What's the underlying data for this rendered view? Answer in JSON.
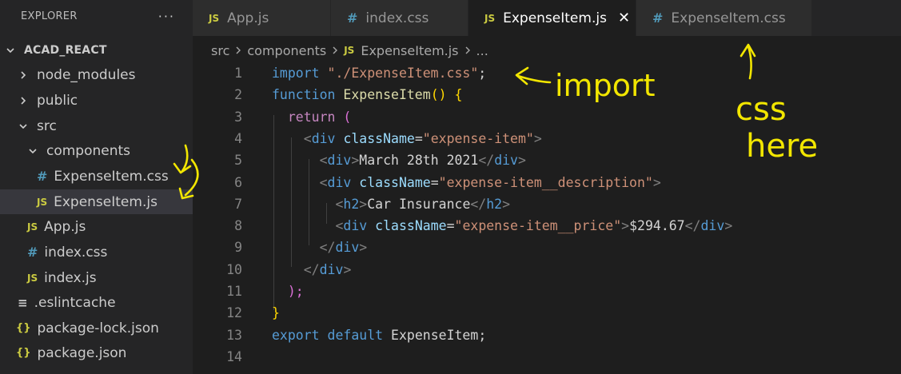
{
  "explorer": {
    "title": "EXPLORER",
    "more": "···",
    "root": "ACAD_REACT",
    "items": [
      {
        "label": "node_modules",
        "icon": "folder-chevron-right-icon"
      },
      {
        "label": "public",
        "icon": "folder-chevron-right-icon"
      },
      {
        "label": "src",
        "icon": "folder-chevron-down-icon"
      },
      {
        "label": "components",
        "icon": "folder-chevron-down-icon"
      },
      {
        "label": "ExpenseItem.css",
        "icon": "css-file-icon",
        "glyph": "#"
      },
      {
        "label": "ExpenseItem.js",
        "icon": "js-file-icon",
        "glyph": "JS",
        "selected": true
      },
      {
        "label": "App.js",
        "icon": "js-file-icon",
        "glyph": "JS"
      },
      {
        "label": "index.css",
        "icon": "css-file-icon",
        "glyph": "#"
      },
      {
        "label": "index.js",
        "icon": "js-file-icon",
        "glyph": "JS"
      },
      {
        "label": ".eslintcache",
        "icon": "lines-file-icon",
        "glyph": "≡"
      },
      {
        "label": "package-lock.json",
        "icon": "json-file-icon",
        "glyph": "{}"
      },
      {
        "label": "package.json",
        "icon": "json-file-icon",
        "glyph": "{}"
      }
    ]
  },
  "tabs": [
    {
      "label": "App.js",
      "glyph": "JS"
    },
    {
      "label": "index.css",
      "glyph": "#"
    },
    {
      "label": "ExpenseItem.js",
      "glyph": "JS",
      "active": true,
      "close": "✕"
    },
    {
      "label": "ExpenseItem.css",
      "glyph": "#"
    }
  ],
  "breadcrumb": {
    "parts": [
      "src",
      "components"
    ],
    "file_glyph": "JS",
    "file": "ExpenseItem.js",
    "tail": "..."
  },
  "code": {
    "line_numbers": [
      "1",
      "2",
      "3",
      "4",
      "5",
      "6",
      "7",
      "8",
      "9",
      "10",
      "11",
      "12",
      "13",
      "14"
    ],
    "lines": [
      [
        {
          "t": "import ",
          "c": "kw"
        },
        {
          "t": "\"./ExpenseItem.css\"",
          "c": "str"
        },
        {
          "t": ";",
          "c": "txt"
        }
      ],
      [
        {
          "t": "function ",
          "c": "kw"
        },
        {
          "t": "ExpenseItem",
          "c": "fn"
        },
        {
          "t": "() ",
          "c": "p1"
        },
        {
          "t": "{",
          "c": "p1"
        }
      ],
      [
        {
          "t": "  "
        },
        {
          "t": "return ",
          "c": "ctl"
        },
        {
          "t": "(",
          "c": "p2"
        }
      ],
      [
        {
          "t": "    "
        },
        {
          "t": "<",
          "c": "tagb"
        },
        {
          "t": "div ",
          "c": "tag"
        },
        {
          "t": "className",
          "c": "attr"
        },
        {
          "t": "=",
          "c": "txt"
        },
        {
          "t": "\"expense-item\"",
          "c": "str"
        },
        {
          "t": ">",
          "c": "tagb"
        }
      ],
      [
        {
          "t": "      "
        },
        {
          "t": "<",
          "c": "tagb"
        },
        {
          "t": "div",
          "c": "tag"
        },
        {
          "t": ">",
          "c": "tagb"
        },
        {
          "t": "March 28th 2021",
          "c": "txt"
        },
        {
          "t": "</",
          "c": "tagb"
        },
        {
          "t": "div",
          "c": "tag"
        },
        {
          "t": ">",
          "c": "tagb"
        }
      ],
      [
        {
          "t": "      "
        },
        {
          "t": "<",
          "c": "tagb"
        },
        {
          "t": "div ",
          "c": "tag"
        },
        {
          "t": "className",
          "c": "attr"
        },
        {
          "t": "=",
          "c": "txt"
        },
        {
          "t": "\"expense-item__description\"",
          "c": "str"
        },
        {
          "t": ">",
          "c": "tagb"
        }
      ],
      [
        {
          "t": "        "
        },
        {
          "t": "<",
          "c": "tagb"
        },
        {
          "t": "h2",
          "c": "tag"
        },
        {
          "t": ">",
          "c": "tagb"
        },
        {
          "t": "Car Insurance",
          "c": "txt"
        },
        {
          "t": "</",
          "c": "tagb"
        },
        {
          "t": "h2",
          "c": "tag"
        },
        {
          "t": ">",
          "c": "tagb"
        }
      ],
      [
        {
          "t": "        "
        },
        {
          "t": "<",
          "c": "tagb"
        },
        {
          "t": "div ",
          "c": "tag"
        },
        {
          "t": "className",
          "c": "attr"
        },
        {
          "t": "=",
          "c": "txt"
        },
        {
          "t": "\"expense-item__price\"",
          "c": "str"
        },
        {
          "t": ">",
          "c": "tagb"
        },
        {
          "t": "$294.67",
          "c": "txt"
        },
        {
          "t": "</",
          "c": "tagb"
        },
        {
          "t": "div",
          "c": "tag"
        },
        {
          "t": ">",
          "c": "tagb"
        }
      ],
      [
        {
          "t": "      "
        },
        {
          "t": "</",
          "c": "tagb"
        },
        {
          "t": "div",
          "c": "tag"
        },
        {
          "t": ">",
          "c": "tagb"
        }
      ],
      [
        {
          "t": "    "
        },
        {
          "t": "</",
          "c": "tagb"
        },
        {
          "t": "div",
          "c": "tag"
        },
        {
          "t": ">",
          "c": "tagb"
        }
      ],
      [
        {
          "t": "  "
        },
        {
          "t": ");",
          "c": "p2"
        }
      ],
      [
        {
          "t": "}",
          "c": "p1"
        }
      ],
      [
        {
          "t": "export ",
          "c": "kw"
        },
        {
          "t": "default ",
          "c": "kw"
        },
        {
          "t": "ExpenseItem",
          "c": "txt"
        },
        {
          "t": ";",
          "c": "txt"
        }
      ],
      []
    ]
  },
  "annotations": {
    "import_note": "import",
    "css_note_line1": "css",
    "css_note_line2": "here",
    "color": "#f2e600"
  }
}
